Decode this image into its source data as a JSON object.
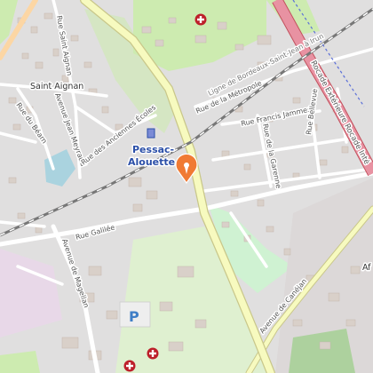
{
  "labels": {
    "place_saint_aignan": "Saint Aignan",
    "station_line1": "Pessac-",
    "station_line2": "Alouette",
    "railway": "Ligne de Bordeaux-Saint-Jean à Irun",
    "ring_road": "Rocade Extérieure Rocade Inté",
    "rue_saint_aignan": "Rue Saint Aignan",
    "rue_du_bearn": "Rue du Béarn",
    "av_jean_meyraud": "Avenue Jean Meyraud",
    "rue_anciennes_ecoles": "Rue des Anciennes Écoles",
    "rue_metropole": "Rue de la Métropole",
    "rue_francis_jammes": "Rue Francis Jammes",
    "rue_garenne": "Rue de la Garenne",
    "rue_bellevue": "Rue Bellevue",
    "rue_galilee": "Rue Galilée",
    "av_magellan": "Avenue de Magellan",
    "av_canejan": "Avenue de Canéjan",
    "area_af": "Af",
    "parking": "P"
  },
  "icons": [
    "hospital-icon",
    "hospital-icon",
    "hospital-icon",
    "map-marker-icon",
    "parking-icon",
    "train-station-icon"
  ],
  "colors": {
    "background": "#f2efe9",
    "residential": "#e0dfdf",
    "building": "#d9d0c9",
    "park": "#c8facc",
    "forest": "#add19e",
    "water": "#aad3df",
    "primary_road": "#f7fabf",
    "primary_casing": "#c9c78a",
    "motorway": "#e892a2",
    "railway": "#777777",
    "marker": "#f07a33",
    "hospital": "#bd1f2a",
    "station": "#2b4fa8"
  }
}
